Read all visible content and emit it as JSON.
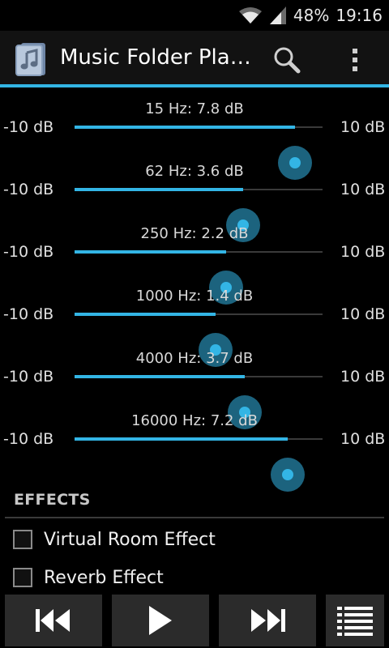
{
  "status_bar": {
    "battery": "48%",
    "time": "19:16",
    "icons": [
      "wifi-icon",
      "signal-icon"
    ]
  },
  "action_bar": {
    "title": "Music Folder Pla…",
    "icons": [
      "music-folder-app-icon",
      "search-icon",
      "overflow-menu-icon"
    ]
  },
  "equalizer": {
    "min_label": "-10 dB",
    "max_label": "10 dB",
    "range": [
      -10,
      10
    ],
    "bands": [
      {
        "label": "15 Hz: 7.8 dB",
        "value": 7.8
      },
      {
        "label": "62 Hz: 3.6 dB",
        "value": 3.6
      },
      {
        "label": "250 Hz: 2.2 dB",
        "value": 2.2
      },
      {
        "label": "1000 Hz: 1.4 dB",
        "value": 1.4
      },
      {
        "label": "4000 Hz: 3.7 dB",
        "value": 3.7
      },
      {
        "label": "16000 Hz: 7.2 dB",
        "value": 7.2
      }
    ]
  },
  "effects": {
    "header": "EFFECTS",
    "items": [
      {
        "label": "Virtual Room Effect",
        "checked": false
      },
      {
        "label": "Reverb Effect",
        "checked": false
      }
    ]
  },
  "controls": {
    "icons": [
      "previous-icon",
      "play-icon",
      "next-icon",
      "playlist-icon"
    ]
  },
  "colors": {
    "accent": "#33b5e5",
    "background": "#000000",
    "action_bar": "#121212",
    "button": "#2b2b2b"
  }
}
